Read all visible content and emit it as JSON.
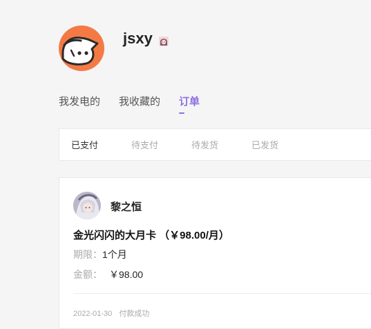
{
  "profile": {
    "username": "jsxy",
    "avatar_icon": "cartoon-face-icon",
    "badge_icon": "anime-girl-badge-icon",
    "avatar_color": "#f47a45"
  },
  "tabs": [
    {
      "label": "我发电的",
      "active": false
    },
    {
      "label": "我收藏的",
      "active": false
    },
    {
      "label": "订单",
      "active": true
    }
  ],
  "filters": [
    {
      "label": "已支付",
      "active": true
    },
    {
      "label": "待支付",
      "active": false
    },
    {
      "label": "待发货",
      "active": false
    },
    {
      "label": "已发货",
      "active": false
    }
  ],
  "order": {
    "creator_name": "黎之恒",
    "plan_title": "金光闪闪的大月卡 （￥98.00/月）",
    "period_label": "期限：",
    "period_value": "1个月",
    "amount_label": "金额：",
    "amount_value": "￥98.00",
    "date": "2022-01-30",
    "status": "付款成功"
  },
  "colors": {
    "accent": "#8c6ee0",
    "background": "#f5f5f5"
  }
}
